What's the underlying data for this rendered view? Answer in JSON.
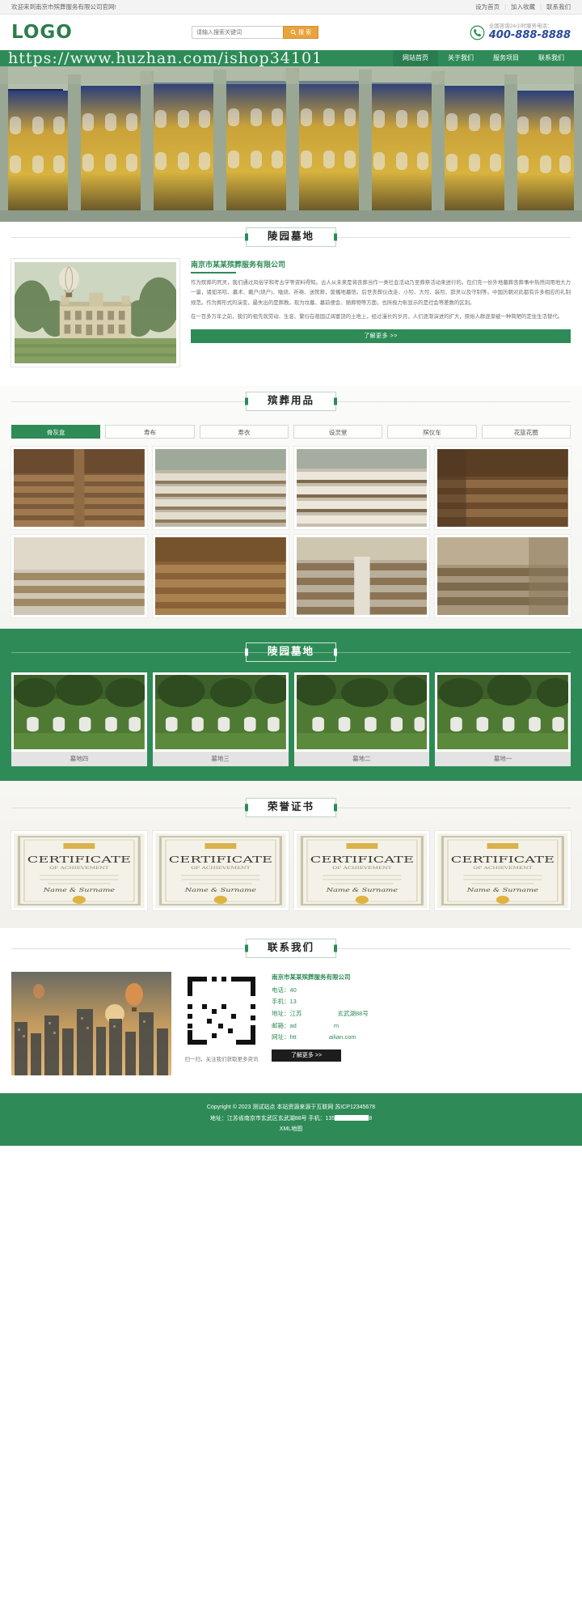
{
  "topbar": {
    "welcome": "欢迎来到南京市殡葬服务有限公司官网!",
    "links": [
      "设为首页",
      "加入收藏",
      "联系我们"
    ],
    "sep": "|"
  },
  "header": {
    "logo": "LOGO",
    "search": {
      "placeholder": "请输入搜索关键词",
      "value": "",
      "button": "搜 索",
      "icon": "search-icon"
    },
    "phone": {
      "label": "全国咨询24小时服务电话：",
      "number": "400-888-8888",
      "icon": "phone-icon"
    }
  },
  "nav": {
    "watermark": "https://www.huzhan.com/ishop34101",
    "items": [
      {
        "label": "网站首页",
        "active": true
      },
      {
        "label": "关于我们",
        "active": false
      },
      {
        "label": "服务项目",
        "active": false
      },
      {
        "label": "联系我们",
        "active": false
      }
    ]
  },
  "banner": {
    "alt": "教堂彩色玻璃花窗横幅"
  },
  "sections": {
    "about_title": "陵园墓地",
    "products_title": "殡葬用品",
    "cemetery_title": "陵园墓地",
    "honors_title": "荣誉证书",
    "contact_title": "联系我们"
  },
  "about": {
    "image_alt": "陵园建筑与热气球插画",
    "company": "南京市某某殡葬服务有限公司",
    "paragraphs": [
      "作为殡葬的死灵，我们通过风俗学和考古学等资料得知。古人从未来是将丧葬当作一类社会活动乃至葬祭活动来进行的。包们充一份外地墓葬丧葬事中热然间用地大力一量，诸如吊唁、墓术、戴户(烧户)、嗑烧、祈祷、送殡葬，废播地墓馆。后世丧葬仪改走、小殓、大殓、装殓、辞灵以及守制等。中国历朝对此都有许多相应的礼制规范。作为葬形式的演变，最失出的是葬教。现为坟墓、墓前便会、随葬物等方面，也所极力彰显示的是社会等差数的区别。",
      "在一百多万年之前，我们的祖先就劳动、生息、繁衍在祖国辽阔富饶的土地上，经过漫长的岁月，人们逐渐演进的扩大，原始人群逐渐被一种简陋的定住生活替代。"
    ],
    "more": "了解更多 >>"
  },
  "products": {
    "tabs": [
      {
        "label": "骨灰盒",
        "active": true
      },
      {
        "label": "寿布",
        "active": false
      },
      {
        "label": "寿衣",
        "active": false
      },
      {
        "label": "设灵堂",
        "active": false
      },
      {
        "label": "殡仪车",
        "active": false
      },
      {
        "label": "花篮花圈",
        "active": false
      }
    ],
    "items": [
      {
        "alt": "礼堂座椅一"
      },
      {
        "alt": "礼堂长椅二"
      },
      {
        "alt": "礼堂长椅三"
      },
      {
        "alt": "木质厅堂四"
      },
      {
        "alt": "厅堂座位五"
      },
      {
        "alt": "木纹礼堂六"
      },
      {
        "alt": "走廊长椅七"
      },
      {
        "alt": "殿堂座椅八"
      }
    ]
  },
  "cemetery": {
    "items": [
      {
        "caption": "墓地四",
        "alt": "墓园草坪墓碑四"
      },
      {
        "caption": "墓地三",
        "alt": "墓园草坪墓碑三"
      },
      {
        "caption": "墓地二",
        "alt": "墓园草坪墓碑二"
      },
      {
        "caption": "墓地一",
        "alt": "墓园草坪墓碑一"
      }
    ]
  },
  "honors": {
    "items": [
      {
        "alt": "荣誉证书一",
        "title": "CERTIFICATE",
        "subtitle": "OF ACHIEVEMENT",
        "name": "Name & Surname"
      },
      {
        "alt": "荣誉证书二",
        "title": "CERTIFICATE",
        "subtitle": "OF ACHIEVEMENT",
        "name": "Name & Surname"
      },
      {
        "alt": "荣誉证书三",
        "title": "CERTIFICATE",
        "subtitle": "OF ACHIEVEMENT",
        "name": "Name & Surname"
      },
      {
        "alt": "荣誉证书四",
        "title": "CERTIFICATE",
        "subtitle": "OF ACHIEVEMENT",
        "name": "Name & Surname"
      }
    ]
  },
  "contact": {
    "image_alt": "黄昏城市与热气球",
    "qr_caption": "扫一扫，关注我们获取更多资讯",
    "company": "南京市某某殡葬服务有限公司",
    "rows": [
      {
        "label": "电话：",
        "value": "40",
        "tail": ""
      },
      {
        "label": "手机：",
        "value": "13",
        "tail": ""
      },
      {
        "label": "地址：",
        "value": "江苏",
        "tail": "玄武湖88号"
      },
      {
        "label": "邮箱：",
        "value": "ad",
        "tail": "m"
      },
      {
        "label": "网址：",
        "value": "htt",
        "tail": "ailian.com"
      }
    ],
    "button": "了解更多 >>"
  },
  "footer": {
    "line1": "Copyright © 2023 测试站点 本站资源来源于互联网 苏ICP12345678",
    "line2_a": "地址：江苏省南京市玄武区玄武湖88号 手机：135",
    "line2_b": "8",
    "line3": "XML地图"
  },
  "colors": {
    "brand": "#2e8b57",
    "accent": "#e8a33d",
    "phone": "#2a4b9b"
  }
}
